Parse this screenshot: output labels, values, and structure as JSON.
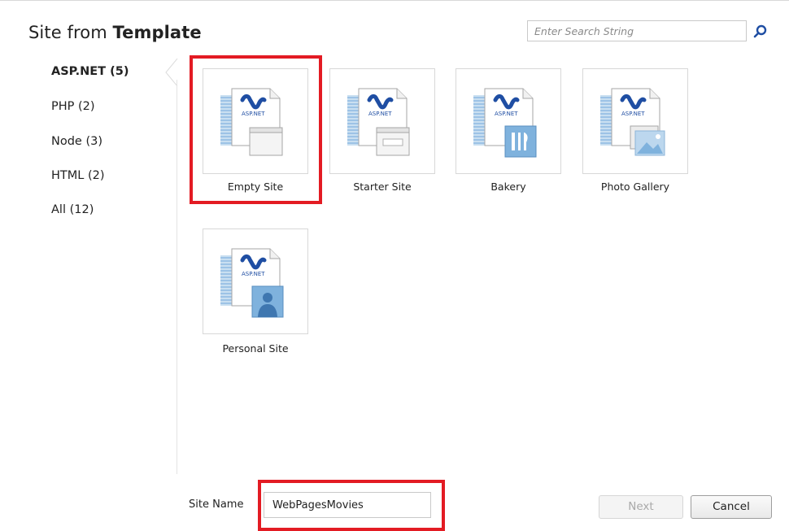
{
  "dialog": {
    "title_prefix": "Site from",
    "title_bold": "Template"
  },
  "search": {
    "placeholder": "Enter Search String",
    "icon": "search-icon"
  },
  "categories": [
    {
      "label": "ASP.NET (5)",
      "selected": true
    },
    {
      "label": "PHP (2)",
      "selected": false
    },
    {
      "label": "Node (3)",
      "selected": false
    },
    {
      "label": "HTML (2)",
      "selected": false
    },
    {
      "label": "All (12)",
      "selected": false
    }
  ],
  "templates": [
    {
      "label": "Empty Site",
      "icon": "empty-site-icon",
      "highlighted": true
    },
    {
      "label": "Starter Site",
      "icon": "starter-site-icon",
      "highlighted": false
    },
    {
      "label": "Bakery",
      "icon": "bakery-icon",
      "highlighted": false
    },
    {
      "label": "Photo Gallery",
      "icon": "photo-gallery-icon",
      "highlighted": false
    },
    {
      "label": "Personal Site",
      "icon": "personal-site-icon",
      "highlighted": false
    }
  ],
  "template_icon_text": "ASP.NET",
  "footer": {
    "site_name_label": "Site Name",
    "site_name_value": "WebPagesMovies",
    "next_label": "Next",
    "cancel_label": "Cancel"
  },
  "colors": {
    "highlight": "#e31b23",
    "asp_blue": "#1f4ea3",
    "icon_light_blue": "#9dc3e6",
    "overlay_blue": "#7fb2dd"
  }
}
